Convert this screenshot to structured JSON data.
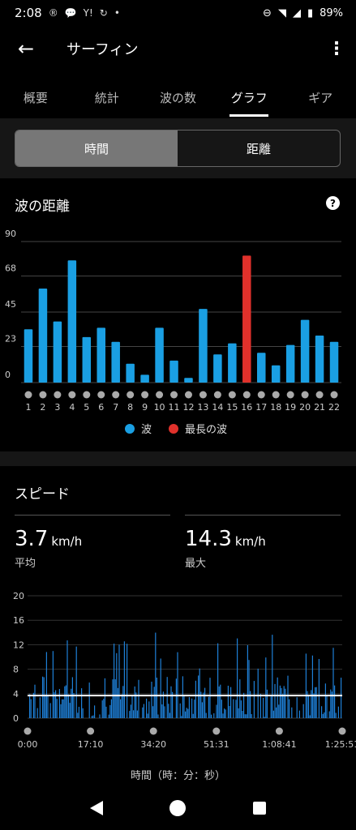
{
  "status_bar": {
    "time": "2:08",
    "battery": "89%",
    "icons": [
      "r-icon",
      "chat-icon",
      "yahoo-icon",
      "sync-icon",
      "dot-icon"
    ],
    "right_icons": [
      "dnd-icon",
      "wifi-icon",
      "signal-icon",
      "battery-icon"
    ]
  },
  "app_bar": {
    "title": "サーフィン"
  },
  "tabs": [
    {
      "label": "概要"
    },
    {
      "label": "統計"
    },
    {
      "label": "波の数"
    },
    {
      "label": "グラフ",
      "active": true
    },
    {
      "label": "ギア"
    }
  ],
  "segment": {
    "left": "時間",
    "right": "距離",
    "selected": "時間"
  },
  "distance_card": {
    "title": "波の距離"
  },
  "speed_card": {
    "title": "スピード",
    "avg": {
      "value": "3.7",
      "unit": "km/h",
      "label": "平均"
    },
    "max": {
      "value": "14.3",
      "unit": "km/h",
      "label": "最大"
    }
  },
  "colors": {
    "wave": "#1a9fe3",
    "longest": "#e0312b",
    "speed_bar": "#1e7fd6"
  },
  "chart_data": [
    {
      "type": "bar",
      "title": "波の距離",
      "categories": [
        "1",
        "2",
        "3",
        "4",
        "5",
        "6",
        "7",
        "8",
        "9",
        "10",
        "11",
        "12",
        "13",
        "14",
        "15",
        "16",
        "17",
        "18",
        "19",
        "20",
        "21",
        "22"
      ],
      "values": [
        34,
        60,
        39,
        78,
        29,
        35,
        26,
        12,
        5,
        35,
        14,
        3,
        47,
        18,
        25,
        81,
        19,
        11,
        24,
        40,
        30,
        26
      ],
      "highlight_index": 15,
      "yticks": [
        0,
        23,
        45,
        68,
        90
      ],
      "ylim": [
        0,
        90
      ],
      "legend": [
        {
          "name": "波",
          "color": "#1a9fe3"
        },
        {
          "name": "最長の波",
          "color": "#e0312b"
        }
      ],
      "legend_position": "bottom",
      "grid": true
    },
    {
      "type": "bar",
      "title": "スピード",
      "xlabel": "時間（時：分：秒）",
      "xticks": [
        "0:00",
        "17:10",
        "34:20",
        "51:31",
        "1:08:41",
        "1:25:51"
      ],
      "yticks": [
        0,
        4,
        8,
        12,
        16,
        20
      ],
      "ylim": [
        0,
        20
      ],
      "average_line": 3.7,
      "series_peak": 14.3,
      "grid": true
    }
  ]
}
